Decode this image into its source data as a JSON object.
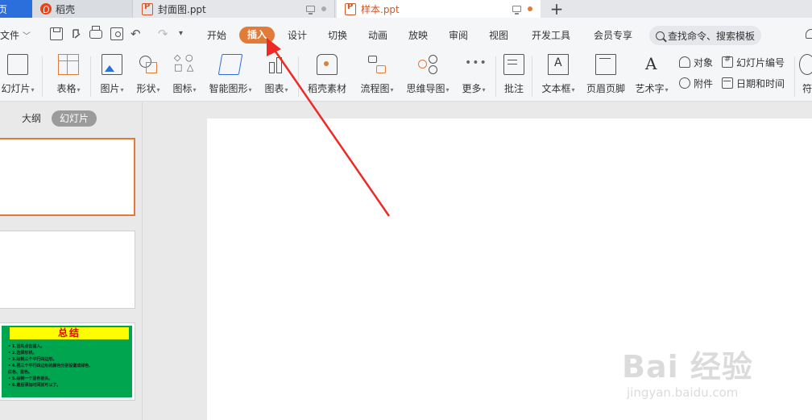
{
  "tabs": {
    "home": "页",
    "daoke": "稻壳",
    "cover": "封面图.ppt",
    "sample": "样本.ppt",
    "add": "+"
  },
  "menu": {
    "file": "文件",
    "items": [
      "开始",
      "插入",
      "设计",
      "切换",
      "动画",
      "放映",
      "审阅",
      "视图",
      "开发工具",
      "会员专享"
    ],
    "active": "插入",
    "search_placeholder": "查找命令、搜索模板"
  },
  "ribbon": {
    "slide": "幻灯片",
    "table": "表格",
    "picture": "图片",
    "shape": "形状",
    "icons": "图标",
    "smartart": "智能图形",
    "chart": "图表",
    "daoke_material": "稻壳素材",
    "flowchart": "流程图",
    "mindmap": "思维导图",
    "more": "更多",
    "comment": "批注",
    "textbox": "文本框",
    "header_footer": "页眉页脚",
    "wordart": "艺术字",
    "object": "对象",
    "slide_number": "幻灯片编号",
    "attachment": "附件",
    "date_time": "日期和时间",
    "symbol": "符"
  },
  "panel": {
    "outline": "大纲",
    "slides": "幻灯片"
  },
  "thumb3": {
    "title": "总结",
    "lines": [
      "• 1.首先点击插入。",
      "• 2.选择形状。",
      "• 3.绘制三个平行四边形。",
      "• 4.把三个平行四边形的颜色分别设置成绿色、",
      "  红色、蓝色。",
      "• 5.绘制一个蓝色箭头。",
      "• 6.最后添加时间就可以了。"
    ]
  },
  "watermark": {
    "brand": "Bai  经验",
    "url": "jingyan.baidu.com"
  },
  "colors": {
    "accent": "#e07b3a",
    "arrow": "#ee2a24",
    "home_tab": "#2a6fdb"
  },
  "icons": [
    "save-icon",
    "export-icon",
    "print-icon",
    "preview-icon",
    "undo-icon",
    "redo-icon",
    "search-icon",
    "cloud-icon"
  ]
}
